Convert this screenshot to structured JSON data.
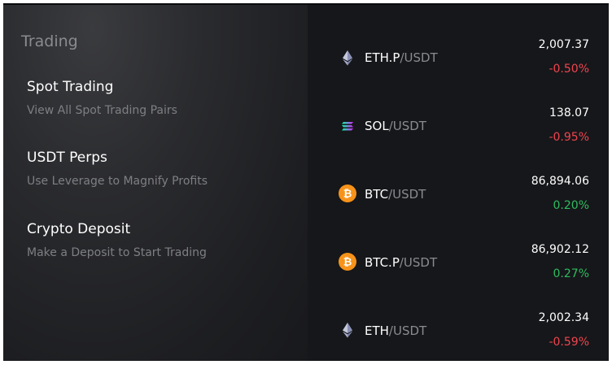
{
  "section": {
    "title": "Trading"
  },
  "menu": [
    {
      "title": "Spot Trading",
      "subtitle": "View All Spot Trading Pairs"
    },
    {
      "title": "USDT Perps",
      "subtitle": "Use Leverage to Magnify Profits"
    },
    {
      "title": "Crypto Deposit",
      "subtitle": "Make a Deposit to Start Trading"
    }
  ],
  "pairs": [
    {
      "base": "ETH.P",
      "quote": "/USDT",
      "price": "2,007.37",
      "change": "-0.50%",
      "icon": "eth-icon"
    },
    {
      "base": "SOL",
      "quote": "/USDT",
      "price": "138.07",
      "change": "-0.95%",
      "icon": "sol-icon"
    },
    {
      "base": "BTC",
      "quote": "/USDT",
      "price": "86,894.06",
      "change": "0.20%",
      "icon": "btc-icon"
    },
    {
      "base": "BTC.P",
      "quote": "/USDT",
      "price": "86,902.12",
      "change": "0.27%",
      "icon": "btc-icon"
    },
    {
      "base": "ETH",
      "quote": "/USDT",
      "price": "2,002.34",
      "change": "-0.59%",
      "icon": "eth-icon"
    }
  ],
  "colors": {
    "up": "#2ebd5f",
    "down": "#f0444f",
    "btc": "#f7931a",
    "background": "#16171a"
  }
}
